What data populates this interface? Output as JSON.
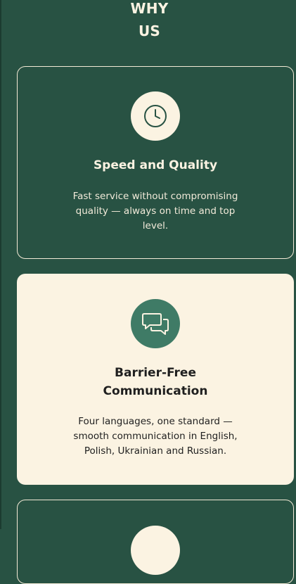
{
  "section": {
    "title_line1": "WHY",
    "title_line2": "US"
  },
  "cards": [
    {
      "icon": "clock-icon",
      "title": "Speed and Quality",
      "text": "Fast service without compromising quality — always on time and top level."
    },
    {
      "icon": "chat-bubbles-icon",
      "title": "Barrier-Free Communication",
      "text": "Four languages, one standard — smooth communication in English, Polish, Ukrainian and Russian."
    }
  ],
  "colors": {
    "background": "#285243",
    "cream": "#fbf3e2",
    "accent": "#3f7b66"
  }
}
